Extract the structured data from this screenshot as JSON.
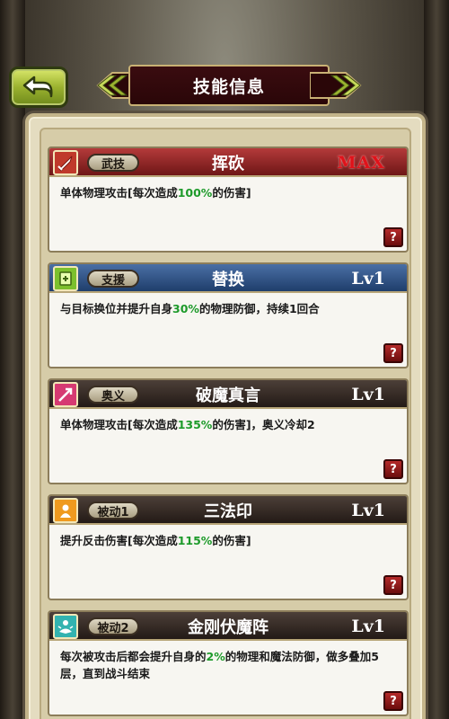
{
  "header": {
    "title": "技能信息",
    "back_icon": "back-arrow-icon"
  },
  "skills": [
    {
      "icon": "sword-icon",
      "icon_color": "#e74c3c",
      "tag": "武技",
      "name": "挥砍",
      "level": "MAX",
      "desc_parts": [
        "单体物理攻击[每次造成",
        "100%",
        "的伤害]"
      ]
    },
    {
      "icon": "support-card-icon",
      "icon_color": "#8fd13a",
      "tag": "支援",
      "name": "替换",
      "level": "Lv1",
      "desc_parts": [
        "与目标换位并提升自身",
        "30%",
        "的物理防御，持续1回合"
      ]
    },
    {
      "icon": "slash-arrow-icon",
      "icon_color": "#e6437b",
      "tag": "奥义",
      "name": "破魔真言",
      "level": "Lv1",
      "desc_parts": [
        "单体物理攻击[每次造成",
        "135%",
        "的伤害]，奥义冷却2"
      ]
    },
    {
      "icon": "figure-icon",
      "icon_color": "#f1a22b",
      "tag": "被动1",
      "name": "三法印",
      "level": "Lv1",
      "desc_parts": [
        "提升反击伤害[每次造成",
        "115%",
        "的伤害]"
      ]
    },
    {
      "icon": "meditate-icon",
      "icon_color": "#3fc4c2",
      "tag": "被动2",
      "name": "金刚伏魔阵",
      "level": "Lv1",
      "desc_parts": [
        "每次被攻击后都会提升自身的",
        "2%",
        "的物理和魔法防御，做多叠加5层，直到战斗结束"
      ]
    }
  ],
  "help_label": "?"
}
